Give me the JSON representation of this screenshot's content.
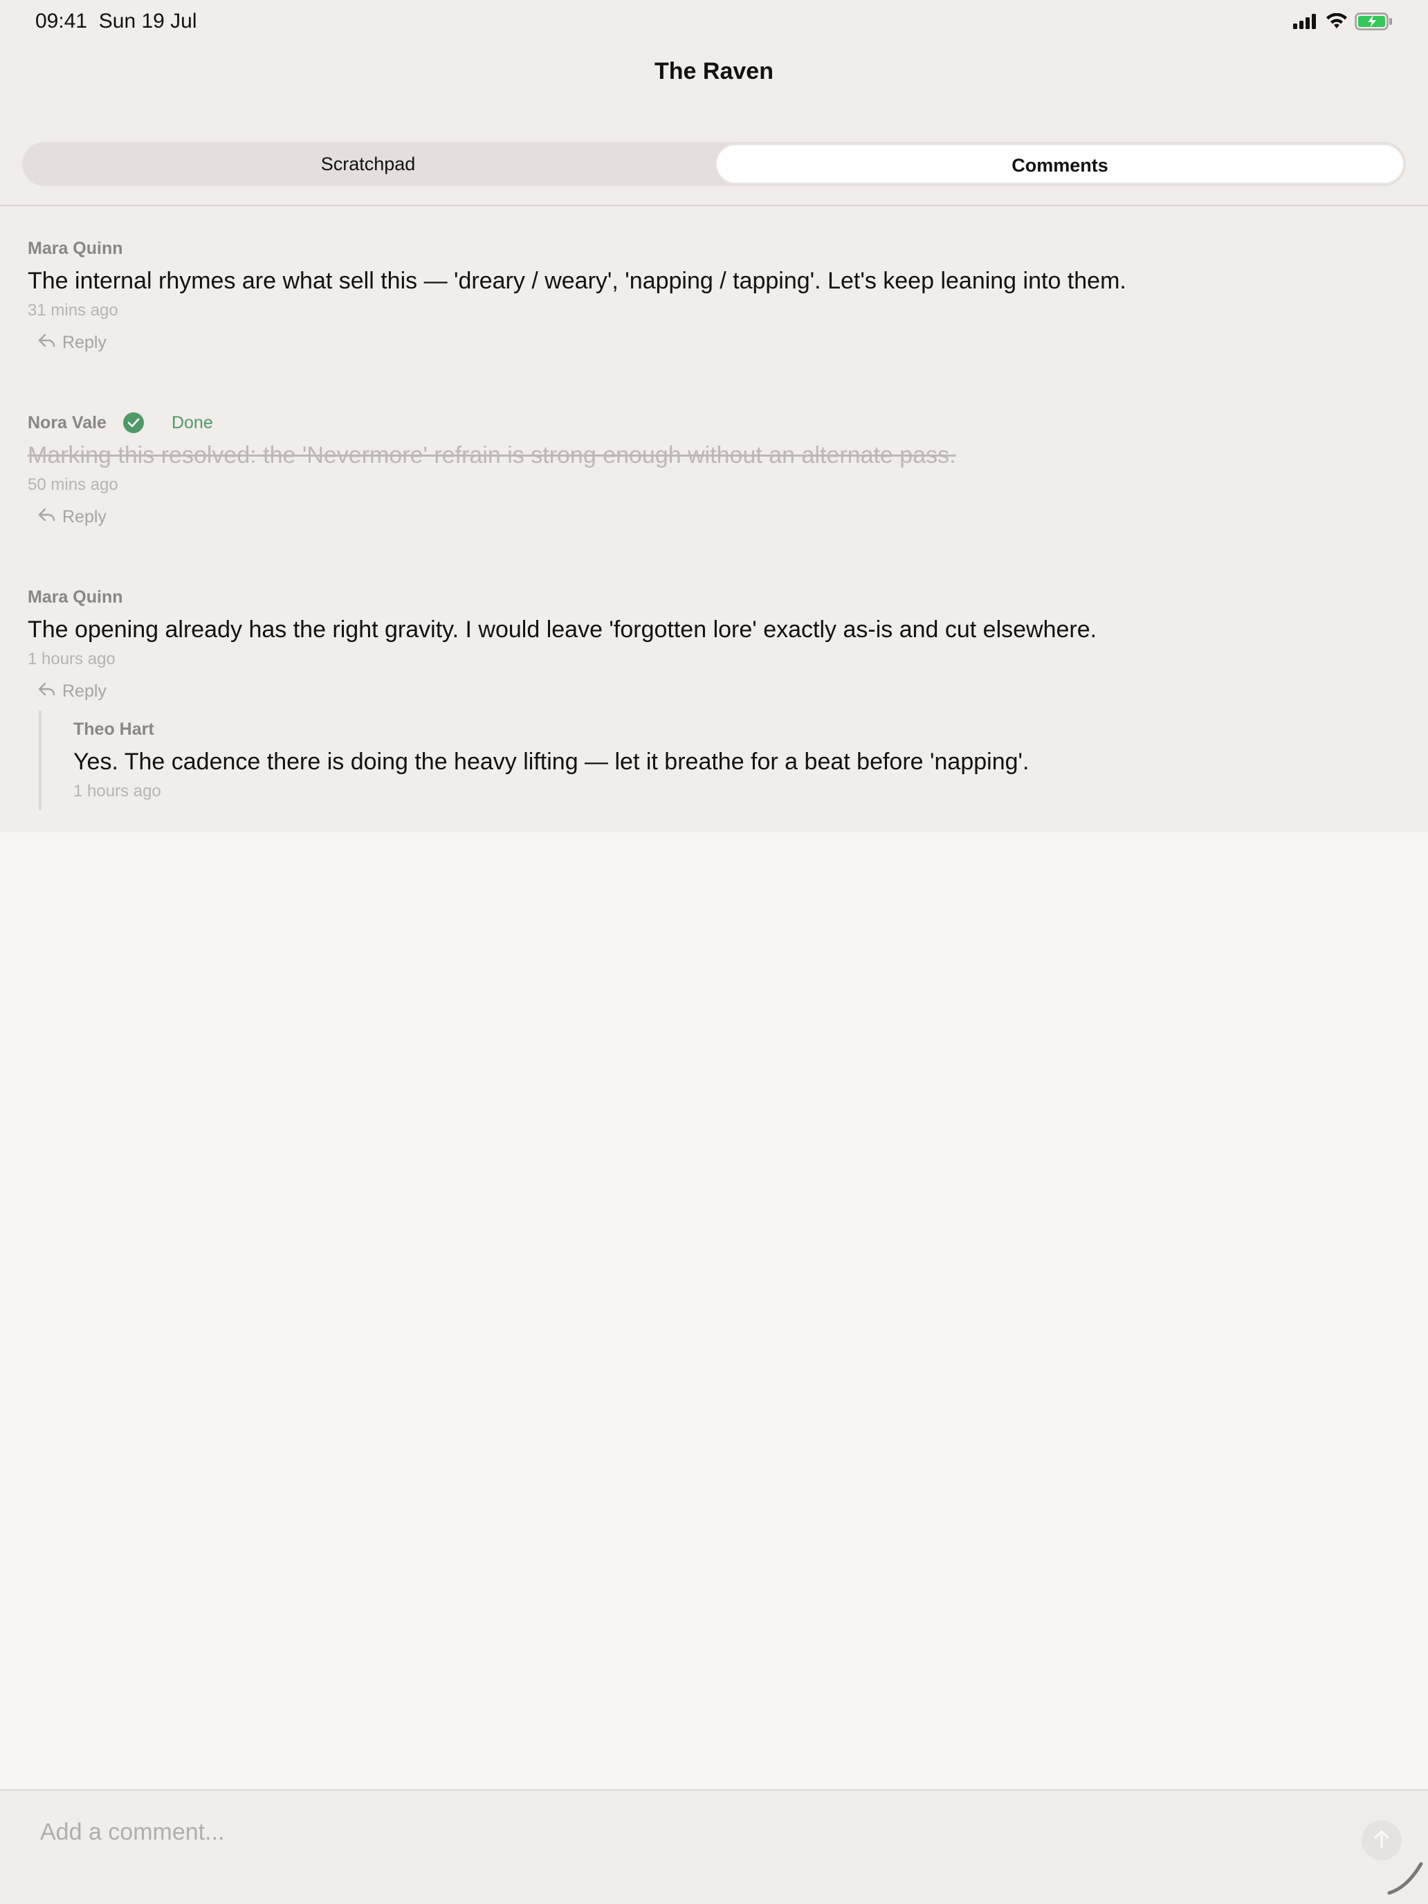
{
  "status_bar": {
    "time": "09:41",
    "date": "Sun 19 Jul",
    "battery_color": "#34c759"
  },
  "header": {
    "title": "The Raven",
    "tabs": [
      {
        "label": "Scratchpad",
        "selected": false
      },
      {
        "label": "Comments",
        "selected": true
      }
    ]
  },
  "comments": [
    {
      "author": "Mara Quinn",
      "body": "The internal rhymes are what sell this — 'dreary / weary', 'napping / tapping'. Let's keep leaning into them.",
      "time": "31 mins ago",
      "reply_label": "Reply"
    },
    {
      "author": "Nora Vale",
      "resolved": true,
      "status_label": "Done",
      "body": "Marking this resolved: the 'Nevermore' refrain is strong enough without an alternate pass.",
      "time": "50 mins ago",
      "reply_label": "Reply"
    },
    {
      "author": "Mara Quinn",
      "body": "The opening already has the right gravity. I would leave 'forgotten lore' exactly as-is and cut elsewhere.",
      "time": "1 hours ago",
      "reply_label": "Reply",
      "replies": [
        {
          "author": "Theo Hart",
          "body": "Yes. The cadence there is doing the heavy lifting — let it breathe for a beat before 'napping'.",
          "time": "1 hours ago"
        }
      ]
    }
  ],
  "composer": {
    "placeholder": "Add a comment...",
    "value": ""
  },
  "colors": {
    "accent_done": "#4e9a66",
    "background": "#f8f5f3",
    "panel": "#f1edea"
  }
}
